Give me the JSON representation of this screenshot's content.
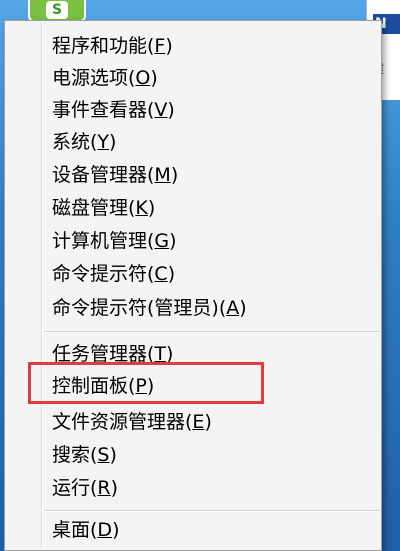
{
  "desktop": {
    "app_icon_glyph": "S",
    "right_window_title": "N",
    "right_window_frag1": "建",
    "right_window_frag2": "\\"
  },
  "menu": {
    "items": [
      {
        "label": "程序和功能(",
        "key": "F",
        "tail": ")"
      },
      {
        "label": "电源选项(",
        "key": "O",
        "tail": ")"
      },
      {
        "label": "事件查看器(",
        "key": "V",
        "tail": ")"
      },
      {
        "label": "系统(",
        "key": "Y",
        "tail": ")"
      },
      {
        "label": "设备管理器(",
        "key": "M",
        "tail": ")"
      },
      {
        "label": "磁盘管理(",
        "key": "K",
        "tail": ")"
      },
      {
        "label": "计算机管理(",
        "key": "G",
        "tail": ")"
      },
      {
        "label": "命令提示符(",
        "key": "C",
        "tail": ")"
      },
      {
        "label": "命令提示符(管理员)(",
        "key": "A",
        "tail": ")"
      },
      {
        "label": "任务管理器(",
        "key": "T",
        "tail": ")"
      },
      {
        "label": "控制面板(",
        "key": "P",
        "tail": ")"
      },
      {
        "label": "文件资源管理器(",
        "key": "E",
        "tail": ")"
      },
      {
        "label": "搜索(",
        "key": "S",
        "tail": ")"
      },
      {
        "label": "运行(",
        "key": "R",
        "tail": ")"
      },
      {
        "label": "桌面(",
        "key": "D",
        "tail": ")"
      }
    ]
  },
  "colors": {
    "menu_background": "#f4f4f4",
    "highlight_border": "#e23b3b"
  }
}
